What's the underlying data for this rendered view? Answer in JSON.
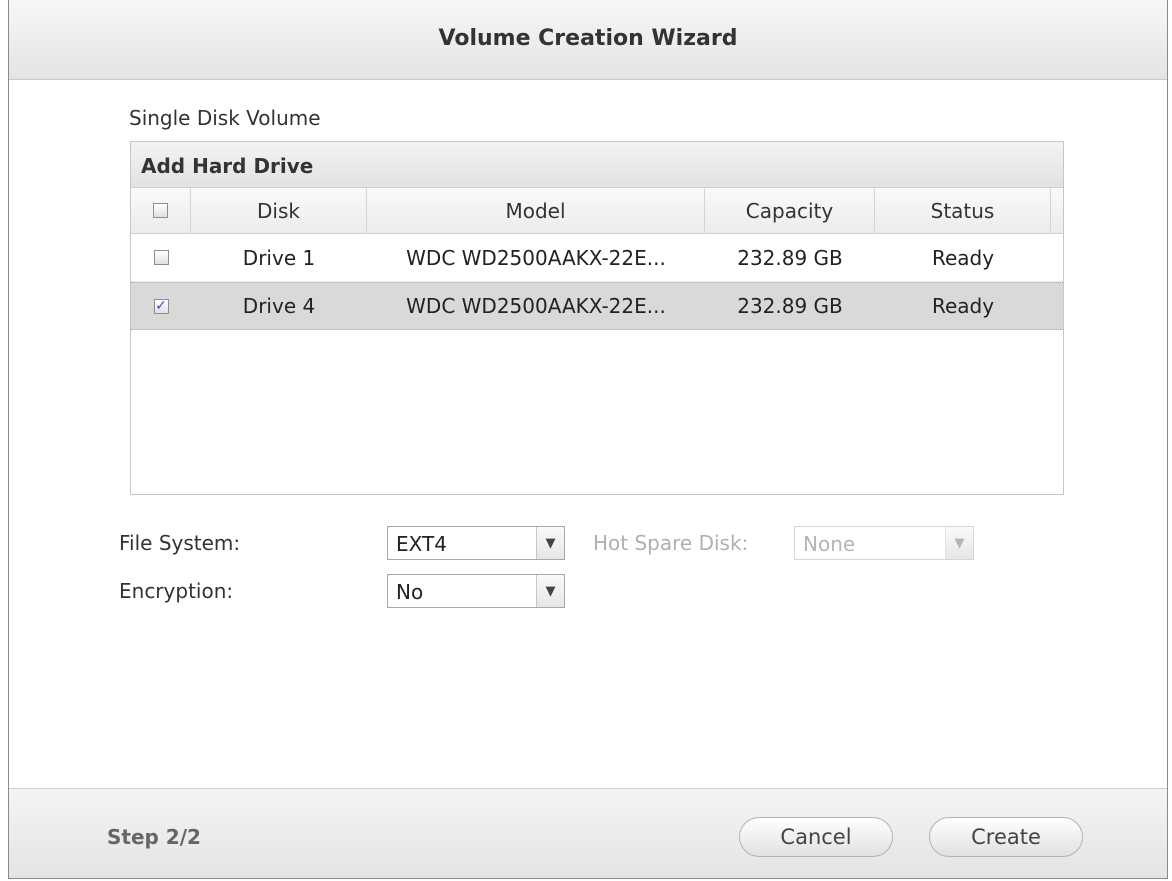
{
  "window": {
    "title": "Volume Creation Wizard"
  },
  "subtitle": "Single Disk Volume",
  "grid": {
    "title": "Add Hard Drive",
    "columns": [
      "Disk",
      "Model",
      "Capacity",
      "Status"
    ],
    "rows": [
      {
        "checked": false,
        "disk": "Drive 1",
        "model": "WDC WD2500AAKX-22E...",
        "capacity": "232.89 GB",
        "status": "Ready"
      },
      {
        "checked": true,
        "disk": "Drive 4",
        "model": "WDC WD2500AAKX-22E...",
        "capacity": "232.89 GB",
        "status": "Ready"
      }
    ]
  },
  "form": {
    "file_system_label": "File System:",
    "file_system_value": "EXT4",
    "hot_spare_label": "Hot Spare Disk:",
    "hot_spare_value": "None",
    "encryption_label": "Encryption:",
    "encryption_value": "No"
  },
  "footer": {
    "step": "Step 2/2",
    "cancel_label": "Cancel",
    "create_label": "Create"
  },
  "icons": {
    "dropdown": "chevron-down-icon",
    "check": "checkmark-icon"
  }
}
